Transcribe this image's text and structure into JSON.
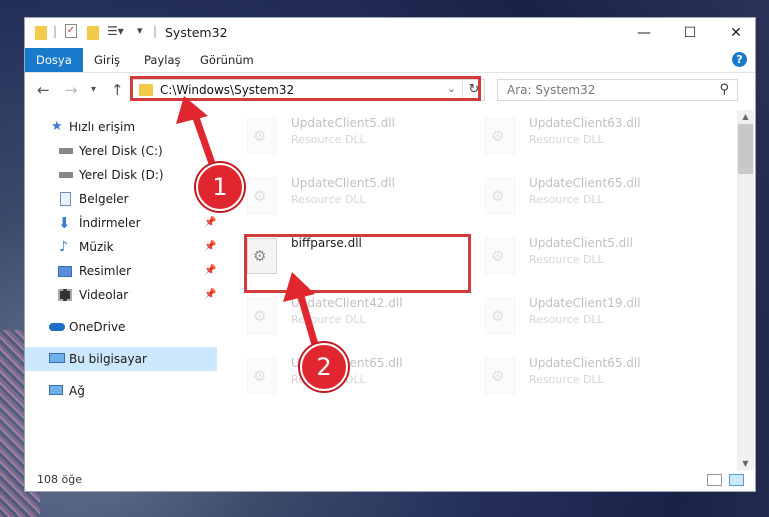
{
  "window": {
    "title": "System32",
    "controls": {
      "minimize": "—",
      "maximize": "☐",
      "close": "✕"
    }
  },
  "ribbon": {
    "tabs": [
      "Dosya",
      "Giriş",
      "Paylaş",
      "Görünüm"
    ],
    "help": "?"
  },
  "address": {
    "path": "C:\\Windows\\System32",
    "search_placeholder": "Ara: System32"
  },
  "sidebar": {
    "items": [
      {
        "label": "Hızlı erişim",
        "icon": "star-icon"
      },
      {
        "label": "Yerel Disk (C:)",
        "icon": "drive-icon"
      },
      {
        "label": "Yerel Disk (D:)",
        "icon": "drive-icon"
      },
      {
        "label": "Belgeler",
        "icon": "documents-icon"
      },
      {
        "label": "İndirmeler",
        "icon": "download-icon"
      },
      {
        "label": "Müzik",
        "icon": "music-icon"
      },
      {
        "label": "Resimler",
        "icon": "pictures-icon"
      },
      {
        "label": "Videolar",
        "icon": "videos-icon"
      },
      {
        "label": "OneDrive",
        "icon": "cloud-icon"
      },
      {
        "label": "Bu bilgisayar",
        "icon": "computer-icon"
      },
      {
        "label": "Ağ",
        "icon": "network-icon"
      }
    ]
  },
  "files": [
    {
      "name": "UpdateClient5.dll",
      "type": "Resource DLL"
    },
    {
      "name": "UpdateClient63.dll",
      "type": "Resource DLL"
    },
    {
      "name": "UpdateClient5.dll",
      "type": "Resource DLL"
    },
    {
      "name": "UpdateClient65.dll",
      "type": "Resource DLL"
    },
    {
      "name": "biffparse.dll",
      "type": ""
    },
    {
      "name": "UpdateClient5.dll",
      "type": "Resource DLL"
    },
    {
      "name": "UpdateClient42.dll",
      "type": "Resource DLL"
    },
    {
      "name": "UpdateClient19.dll",
      "type": "Resource DLL"
    },
    {
      "name": "UpdateClient65.dll",
      "type": "Resource DLL"
    },
    {
      "name": "UpdateClient65.dll",
      "type": "Resource DLL"
    }
  ],
  "status": {
    "count": "108 öğe"
  },
  "annotations": {
    "step1": "1",
    "step2": "2"
  },
  "colors": {
    "accent": "#1979ca",
    "highlight": "#d23b3b",
    "selected": "#cce8ff"
  }
}
